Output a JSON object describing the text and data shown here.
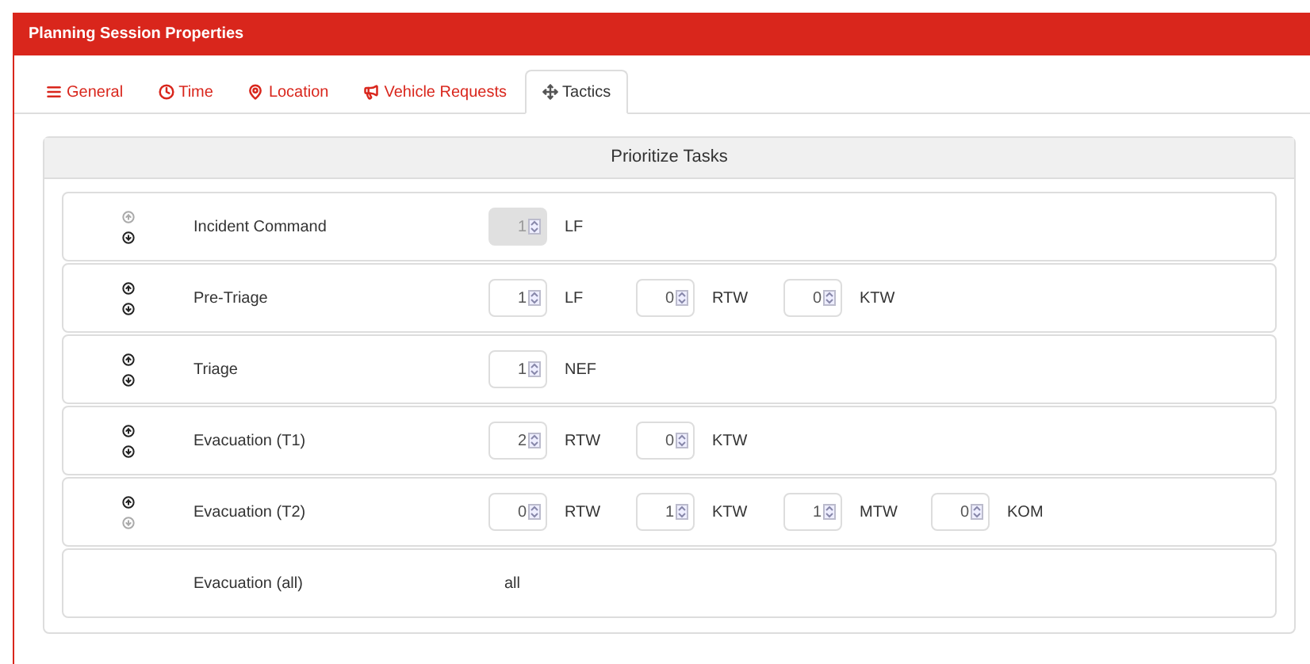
{
  "window": {
    "title": "Planning Session Properties"
  },
  "tabs": [
    {
      "label": "General",
      "kind": "general",
      "selected": false
    },
    {
      "label": "Time",
      "kind": "time",
      "selected": false
    },
    {
      "label": "Location",
      "kind": "location",
      "selected": false
    },
    {
      "label": "Vehicle Requests",
      "kind": "requests",
      "selected": false
    },
    {
      "label": "Tactics",
      "kind": "tactics",
      "selected": true
    }
  ],
  "panel": {
    "title": "Prioritize Tasks"
  },
  "tasks": [
    {
      "kind": "spinners",
      "name": "Incident Command",
      "up_disabled": true,
      "down_disabled": false,
      "units": [
        {
          "count": "1",
          "disabled": true,
          "type": "LF"
        }
      ]
    },
    {
      "kind": "spinners",
      "name": "Pre-Triage",
      "up_disabled": false,
      "down_disabled": false,
      "units": [
        {
          "count": "1",
          "disabled": false,
          "type": "LF"
        },
        {
          "count": "0",
          "disabled": false,
          "type": "RTW"
        },
        {
          "count": "0",
          "disabled": false,
          "type": "KTW"
        }
      ]
    },
    {
      "kind": "spinners",
      "name": "Triage",
      "up_disabled": false,
      "down_disabled": false,
      "units": [
        {
          "count": "1",
          "disabled": false,
          "type": "NEF"
        }
      ]
    },
    {
      "kind": "spinners",
      "name": "Evacuation (T1)",
      "up_disabled": false,
      "down_disabled": false,
      "units": [
        {
          "count": "2",
          "disabled": false,
          "type": "RTW"
        },
        {
          "count": "0",
          "disabled": false,
          "type": "KTW"
        }
      ]
    },
    {
      "kind": "spinners",
      "name": "Evacuation (T2)",
      "up_disabled": false,
      "down_disabled": true,
      "units": [
        {
          "count": "0",
          "disabled": false,
          "type": "RTW"
        },
        {
          "count": "1",
          "disabled": false,
          "type": "KTW"
        },
        {
          "count": "1",
          "disabled": false,
          "type": "MTW"
        },
        {
          "count": "0",
          "disabled": false,
          "type": "KOM"
        }
      ]
    },
    {
      "kind": "text",
      "name": "Evacuation (all)",
      "value": "all"
    }
  ]
}
